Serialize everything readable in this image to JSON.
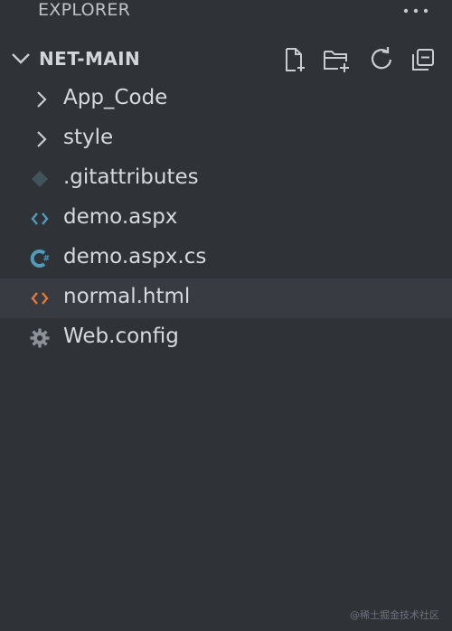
{
  "explorer": {
    "title": "EXPLORER",
    "more_icon": "ellipsis-icon"
  },
  "section": {
    "title": "NET-MAIN",
    "actions": [
      {
        "icon": "new-file-icon"
      },
      {
        "icon": "new-folder-icon"
      },
      {
        "icon": "refresh-icon"
      },
      {
        "icon": "collapse-all-icon"
      }
    ]
  },
  "tree": [
    {
      "label": "App_Code",
      "type": "folder",
      "icon": "chevron-right-icon"
    },
    {
      "label": "style",
      "type": "folder",
      "icon": "chevron-right-icon"
    },
    {
      "label": ".gitattributes",
      "type": "file",
      "icon": "git-file-icon",
      "icon_color": "#41535b"
    },
    {
      "label": "demo.aspx",
      "type": "file",
      "icon": "code-brackets-icon",
      "icon_color": "#519aba"
    },
    {
      "label": "demo.aspx.cs",
      "type": "file",
      "icon": "csharp-icon",
      "icon_color": "#519aba"
    },
    {
      "label": "normal.html",
      "type": "file",
      "icon": "html-icon",
      "icon_color": "#e37933",
      "hovered": true
    },
    {
      "label": "Web.config",
      "type": "file",
      "icon": "gear-icon",
      "icon_color": "#8a9199"
    }
  ],
  "watermark": "@稀土掘金技术社区"
}
